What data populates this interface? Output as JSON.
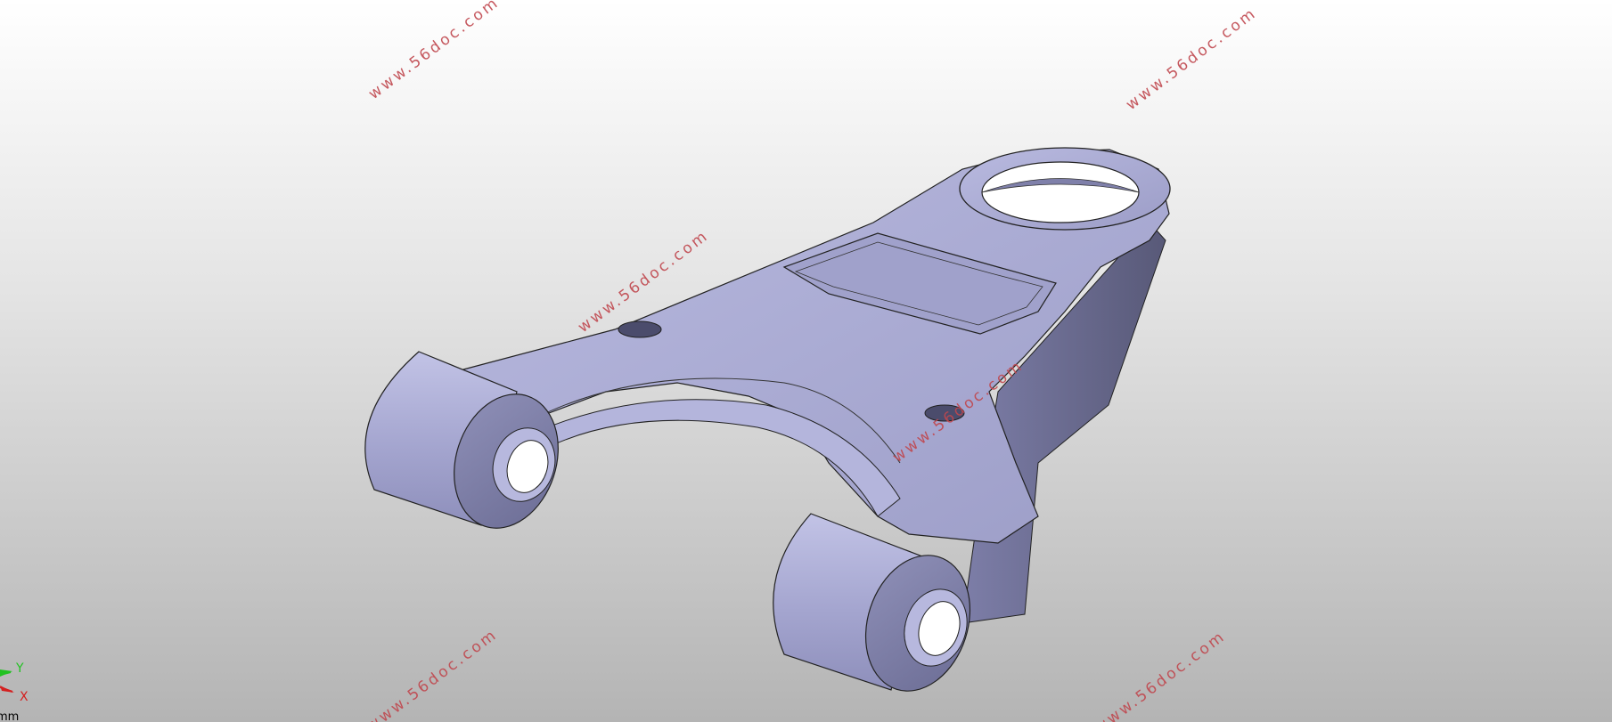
{
  "watermarks": [
    "www.56doc.com",
    "www.56doc.com",
    "www.56doc.com",
    "www.56doc.com",
    "www.56doc.com",
    "www.56doc.com"
  ],
  "axis_triad": {
    "y_label": "Y",
    "x_label": "X"
  },
  "unit_label": "mm",
  "colors": {
    "part": "#a7a8d0",
    "part_shadow": "#5e5f86",
    "watermark": "#c0474e",
    "axis_x": "#d42020",
    "axis_y": "#22c222"
  }
}
